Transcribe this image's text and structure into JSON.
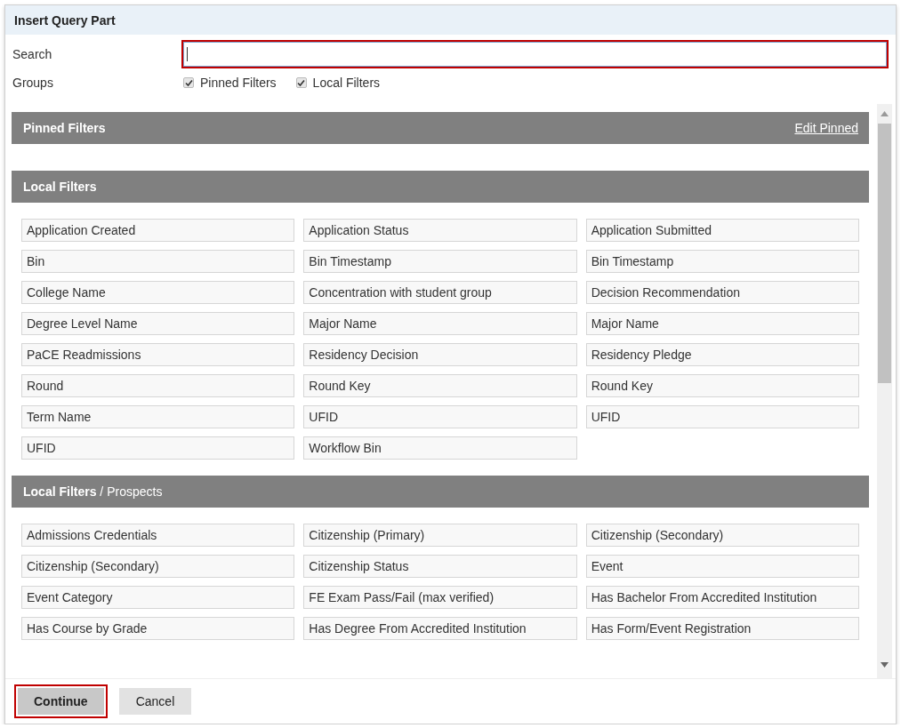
{
  "dialog": {
    "title": "Insert Query Part"
  },
  "search": {
    "label": "Search",
    "focused": true
  },
  "groups": {
    "label": "Groups",
    "options": [
      {
        "label": "Pinned Filters",
        "checked": true
      },
      {
        "label": "Local Filters",
        "checked": true
      }
    ]
  },
  "sections": [
    {
      "title": "Pinned Filters",
      "action": "Edit Pinned"
    },
    {
      "title": "Local Filters",
      "items": [
        "Application Created",
        "Application Status",
        "Application Submitted",
        "Bin",
        "Bin Timestamp",
        "Bin Timestamp",
        "College Name",
        "Concentration with student group",
        "Decision Recommendation",
        "Degree Level Name",
        "Major Name",
        "Major Name",
        "PaCE Readmissions",
        "Residency Decision",
        "Residency Pledge",
        "Round",
        "Round Key",
        "Round Key",
        "Term Name",
        "UFID",
        "UFID",
        "UFID",
        "Workflow Bin"
      ]
    },
    {
      "title": "Local Filters",
      "subtitle": "/ Prospects",
      "items": [
        "Admissions Credentials",
        "Citizenship (Primary)",
        "Citizenship (Secondary)",
        "Citizenship (Secondary)",
        "Citizenship Status",
        "Event",
        "Event Category",
        "FE Exam Pass/Fail (max verified)",
        "Has Bachelor From Accredited Institution",
        "Has Course by Grade",
        "Has Degree From Accredited Institution",
        "Has Form/Event Registration"
      ]
    }
  ],
  "buttons": [
    {
      "label": "Continue",
      "kind": "primary",
      "highlighted": true
    },
    {
      "label": "Cancel",
      "kind": "secondary",
      "highlighted": false
    }
  ]
}
